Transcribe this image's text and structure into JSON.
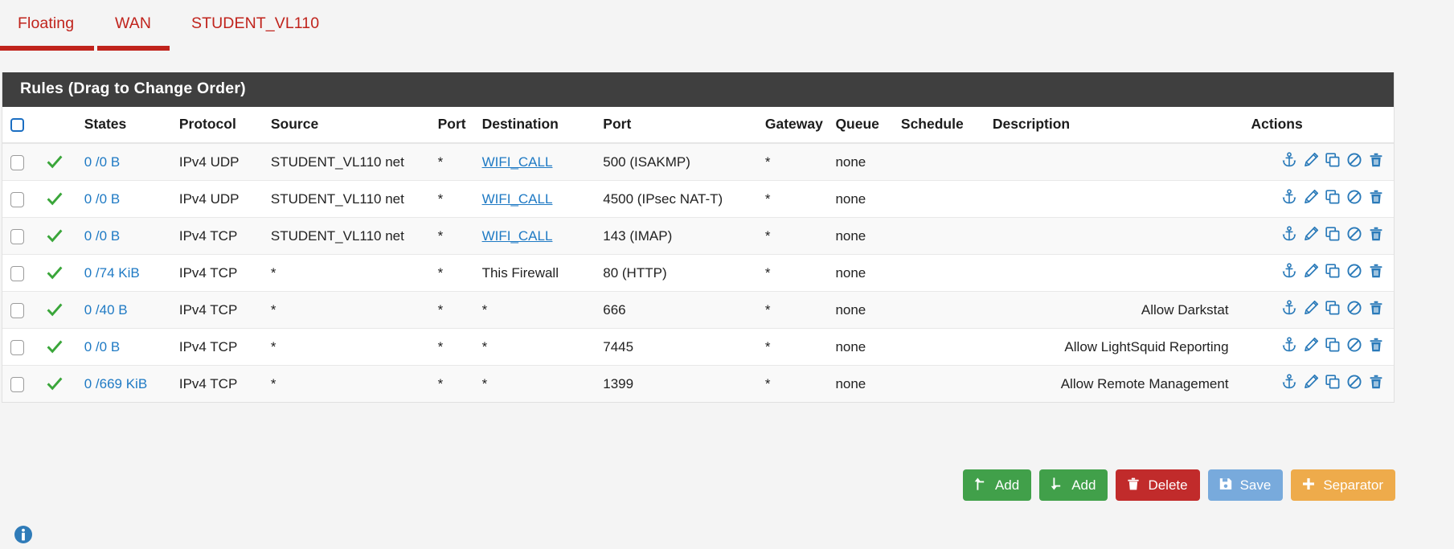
{
  "tabs": [
    {
      "label": "Floating",
      "active": true
    },
    {
      "label": "WAN",
      "active": true
    },
    {
      "label": "STUDENT_VL110",
      "active": false
    }
  ],
  "panel": {
    "title": "Rules (Drag to Change Order)"
  },
  "table": {
    "columns": [
      "",
      "",
      "States",
      "Protocol",
      "Source",
      "Port",
      "Destination",
      "Port",
      "Gateway",
      "Queue",
      "Schedule",
      "Description",
      "Actions"
    ],
    "headers": {
      "states": "States",
      "protocol": "Protocol",
      "source": "Source",
      "source_port": "Port",
      "destination": "Destination",
      "destination_port": "Port",
      "gateway": "Gateway",
      "queue": "Queue",
      "schedule": "Schedule",
      "description": "Description",
      "actions": "Actions"
    },
    "rows": [
      {
        "states": "0 /0 B",
        "protocol": "IPv4 UDP",
        "source": "STUDENT_VL110 net",
        "source_port": "*",
        "destination": "WIFI_CALL",
        "destination_is_link": true,
        "destination_port": "500 (ISAKMP)",
        "gateway": "*",
        "queue": "none",
        "schedule": "",
        "description": ""
      },
      {
        "states": "0 /0 B",
        "protocol": "IPv4 UDP",
        "source": "STUDENT_VL110 net",
        "source_port": "*",
        "destination": "WIFI_CALL",
        "destination_is_link": true,
        "destination_port": "4500 (IPsec NAT-T)",
        "gateway": "*",
        "queue": "none",
        "schedule": "",
        "description": ""
      },
      {
        "states": "0 /0 B",
        "protocol": "IPv4 TCP",
        "source": "STUDENT_VL110 net",
        "source_port": "*",
        "destination": "WIFI_CALL",
        "destination_is_link": true,
        "destination_port": "143 (IMAP)",
        "gateway": "*",
        "queue": "none",
        "schedule": "",
        "description": ""
      },
      {
        "states": "0 /74 KiB",
        "protocol": "IPv4 TCP",
        "source": "*",
        "source_port": "*",
        "destination": "This Firewall",
        "destination_is_link": false,
        "destination_port": "80 (HTTP)",
        "gateway": "*",
        "queue": "none",
        "schedule": "",
        "description": ""
      },
      {
        "states": "0 /40 B",
        "protocol": "IPv4 TCP",
        "source": "*",
        "source_port": "*",
        "destination": "*",
        "destination_is_link": false,
        "destination_port": "666",
        "gateway": "*",
        "queue": "none",
        "schedule": "",
        "description": "Allow Darkstat"
      },
      {
        "states": "0 /0 B",
        "protocol": "IPv4 TCP",
        "source": "*",
        "source_port": "*",
        "destination": "*",
        "destination_is_link": false,
        "destination_port": "7445",
        "gateway": "*",
        "queue": "none",
        "schedule": "",
        "description": "Allow LightSquid Reporting"
      },
      {
        "states": "0 /669 KiB",
        "protocol": "IPv4 TCP",
        "source": "*",
        "source_port": "*",
        "destination": "*",
        "destination_is_link": false,
        "destination_port": "1399",
        "gateway": "*",
        "queue": "none",
        "schedule": "",
        "description": "Allow Remote Management"
      }
    ],
    "row_action_icons": [
      "anchor-icon",
      "edit-pencil-icon",
      "copy-icon",
      "block-icon",
      "delete-trash-icon"
    ]
  },
  "buttons": [
    {
      "label": "Add",
      "icon": "arrow-up-add-icon",
      "color": "#41a04a"
    },
    {
      "label": "Add",
      "icon": "arrow-down-add-icon",
      "color": "#41a04a"
    },
    {
      "label": "Delete",
      "icon": "trash-icon",
      "color": "#c12b2b"
    },
    {
      "label": "Save",
      "icon": "floppy-save-icon",
      "color": "#78aadc"
    },
    {
      "label": "Separator",
      "icon": "plus-icon",
      "color": "#eeab4b"
    }
  ],
  "footer": {
    "info_icon": "info-circle-icon"
  },
  "colors": {
    "tab_active": "#c0231c",
    "panel_header_bg": "#3f3f3f",
    "link": "#1f7ac4",
    "pass_check": "#3aa63a",
    "action_icon": "#2a7ab9",
    "info_icon": "#2f7bb8"
  }
}
